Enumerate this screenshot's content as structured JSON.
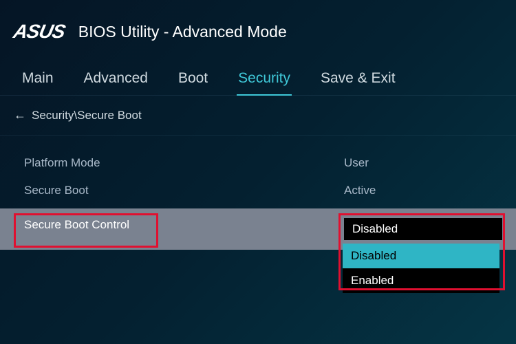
{
  "header": {
    "logo": "ASUS",
    "title": "BIOS Utility - Advanced Mode"
  },
  "tabs": {
    "items": [
      {
        "label": "Main",
        "active": false
      },
      {
        "label": "Advanced",
        "active": false
      },
      {
        "label": "Boot",
        "active": false
      },
      {
        "label": "Security",
        "active": true
      },
      {
        "label": "Save & Exit",
        "active": false
      }
    ]
  },
  "breadcrumb": {
    "arrow": "←",
    "path": "Security\\Secure Boot"
  },
  "settings": {
    "platform_mode": {
      "label": "Platform Mode",
      "value": "User"
    },
    "secure_boot": {
      "label": "Secure Boot",
      "value": "Active"
    },
    "secure_boot_control": {
      "label": "Secure Boot Control",
      "value": "Disabled"
    }
  },
  "dropdown": {
    "options": [
      {
        "label": "Disabled",
        "highlighted": true
      },
      {
        "label": "Enabled",
        "highlighted": false
      }
    ]
  }
}
